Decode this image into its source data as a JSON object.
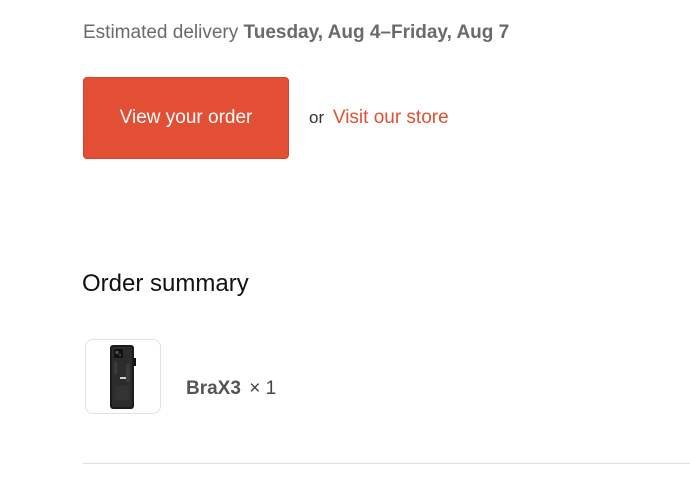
{
  "delivery": {
    "label": "Estimated delivery",
    "dates": "Tuesday, Aug 4–Friday, Aug 7"
  },
  "actions": {
    "view_order_label": "View your order",
    "or_text": "or",
    "visit_store_label": "Visit our store"
  },
  "summary": {
    "title": "Order summary",
    "items": [
      {
        "name": "BraX3",
        "quantity": "× 1",
        "image_icon": "phone-product-icon"
      }
    ]
  },
  "colors": {
    "accent": "#e34f35",
    "text_muted": "#6a6a6a",
    "divider": "#e0e0e0"
  }
}
